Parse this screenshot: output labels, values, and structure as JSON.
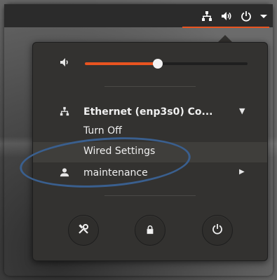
{
  "tray": {
    "icons": [
      "network-wired-icon",
      "volume-icon",
      "power-icon",
      "menu-dropdown-icon"
    ],
    "accent_color": "#e95420"
  },
  "volume": {
    "level_percent": 45
  },
  "network": {
    "title": "Ethernet (enp3s0) Co...",
    "items": [
      {
        "label": "Turn Off"
      },
      {
        "label": "Wired Settings"
      }
    ]
  },
  "user": {
    "name": "maintenance"
  },
  "actions": [
    {
      "name": "settings-icon"
    },
    {
      "name": "lock-icon"
    },
    {
      "name": "power-icon"
    }
  ],
  "annotation": {
    "shape": "ellipse",
    "color": "#3a5f8e"
  }
}
